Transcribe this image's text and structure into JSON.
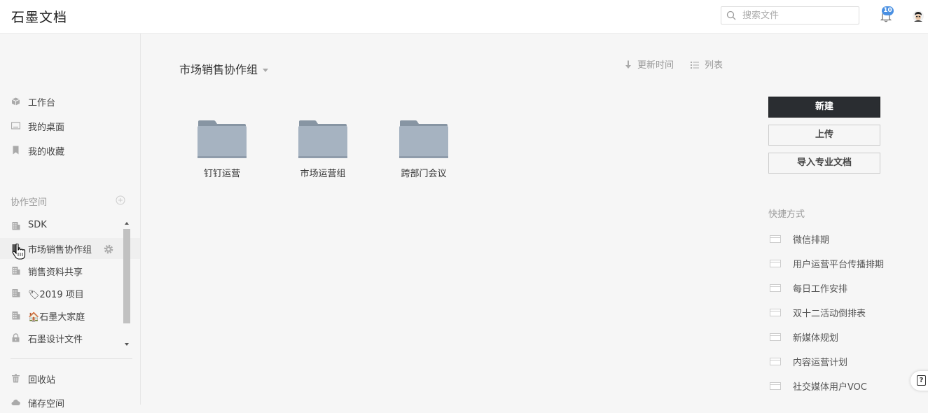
{
  "app": {
    "logo": "石墨文档"
  },
  "search": {
    "placeholder": "搜索文件",
    "value": ""
  },
  "notifications": {
    "count": "10"
  },
  "sidebar": {
    "nav": [
      {
        "label": "工作台",
        "icon": "workbench-icon"
      },
      {
        "label": "我的桌面",
        "icon": "desktop-icon"
      },
      {
        "label": "我的收藏",
        "icon": "bookmark-icon"
      }
    ],
    "spaces_title": "协作空间",
    "spaces": [
      {
        "label": "SDK",
        "icon": "building-icon",
        "emoji": ""
      },
      {
        "label": "市场销售协作组",
        "icon": "building-icon",
        "emoji": "",
        "active": true
      },
      {
        "label": "销售资料共享",
        "icon": "building-icon",
        "emoji": ""
      },
      {
        "label": "2019 项目",
        "icon": "building-icon",
        "emoji": "🏷"
      },
      {
        "label": "石墨大家庭",
        "icon": "building-icon",
        "emoji": "🏠"
      },
      {
        "label": "石墨设计文件",
        "icon": "lock-icon",
        "emoji": ""
      }
    ],
    "bottom": [
      {
        "label": "回收站",
        "icon": "trash-icon"
      },
      {
        "label": "储存空间",
        "icon": "cloud-icon"
      }
    ]
  },
  "main": {
    "title": "市场销售协作组",
    "sort_label": "更新时间",
    "view_label": "列表",
    "folders": [
      {
        "name": "钉钉运营"
      },
      {
        "name": "市场运营组"
      },
      {
        "name": "跨部门会议"
      }
    ]
  },
  "actions": {
    "new_label": "新建",
    "upload_label": "上传",
    "import_label": "导入专业文档"
  },
  "shortcuts": {
    "title": "快捷方式",
    "items": [
      {
        "label": "微信排期"
      },
      {
        "label": "用户运营平台传播排期"
      },
      {
        "label": "每日工作安排"
      },
      {
        "label": "双十二活动倒排表"
      },
      {
        "label": "新媒体规划"
      },
      {
        "label": "内容运营计划"
      },
      {
        "label": "社交媒体用户VOC"
      }
    ]
  },
  "help": {
    "label": "?"
  },
  "colors": {
    "primary_button": "#2a2d31",
    "badge": "#4a90e2",
    "folder": "#9aa8b6",
    "background": "#f6f6f6"
  }
}
